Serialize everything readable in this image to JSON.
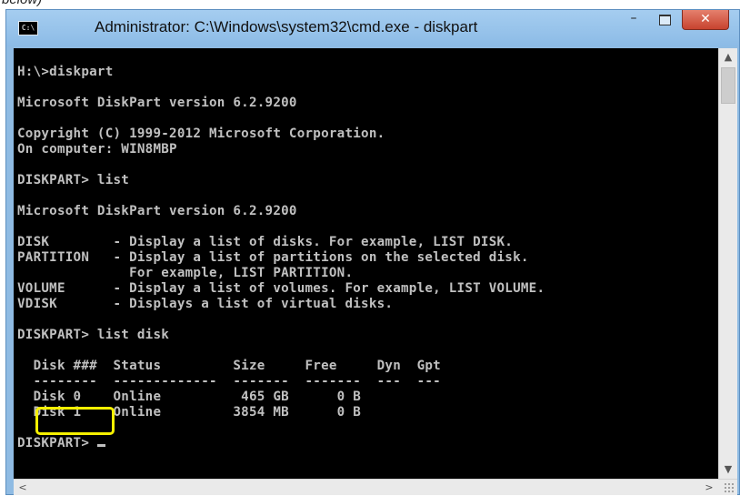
{
  "caption": "below)",
  "window": {
    "title": "Administrator: C:\\Windows\\system32\\cmd.exe - diskpart",
    "icon": "console-window-icon",
    "icon_text": "C:\\",
    "minimize_icon": "minimize-icon",
    "minimize_glyph": "–",
    "maximize_icon": "maximize-icon",
    "close_icon": "close-icon",
    "close_glyph": "✕"
  },
  "console": {
    "lines": [
      "H:\\>diskpart",
      "",
      "Microsoft DiskPart version 6.2.9200",
      "",
      "Copyright (C) 1999-2012 Microsoft Corporation.",
      "On computer: WIN8MBP",
      "",
      "DISKPART> list",
      "",
      "Microsoft DiskPart version 6.2.9200",
      "",
      "DISK        - Display a list of disks. For example, LIST DISK.",
      "PARTITION   - Display a list of partitions on the selected disk.",
      "              For example, LIST PARTITION.",
      "VOLUME      - Display a list of volumes. For example, LIST VOLUME.",
      "VDISK       - Displays a list of virtual disks.",
      "",
      "DISKPART> list disk",
      "",
      "  Disk ###  Status         Size     Free     Dyn  Gpt",
      "  --------  -------------  -------  -------  ---  ---",
      "  Disk 0    Online          465 GB      0 B",
      "  Disk 1    Online         3854 MB      0 B",
      ""
    ],
    "prompt": "DISKPART> "
  },
  "colors": {
    "console_bg": "#000000",
    "console_text": "#c0c0c0",
    "highlight": "#f5f000",
    "titlebar": "#8fbbe3",
    "close_button": "#c7432f"
  },
  "scrollbars": {
    "up_arrow": "▲",
    "down_arrow": "▼",
    "left_arrow": "<",
    "right_arrow": ">"
  }
}
